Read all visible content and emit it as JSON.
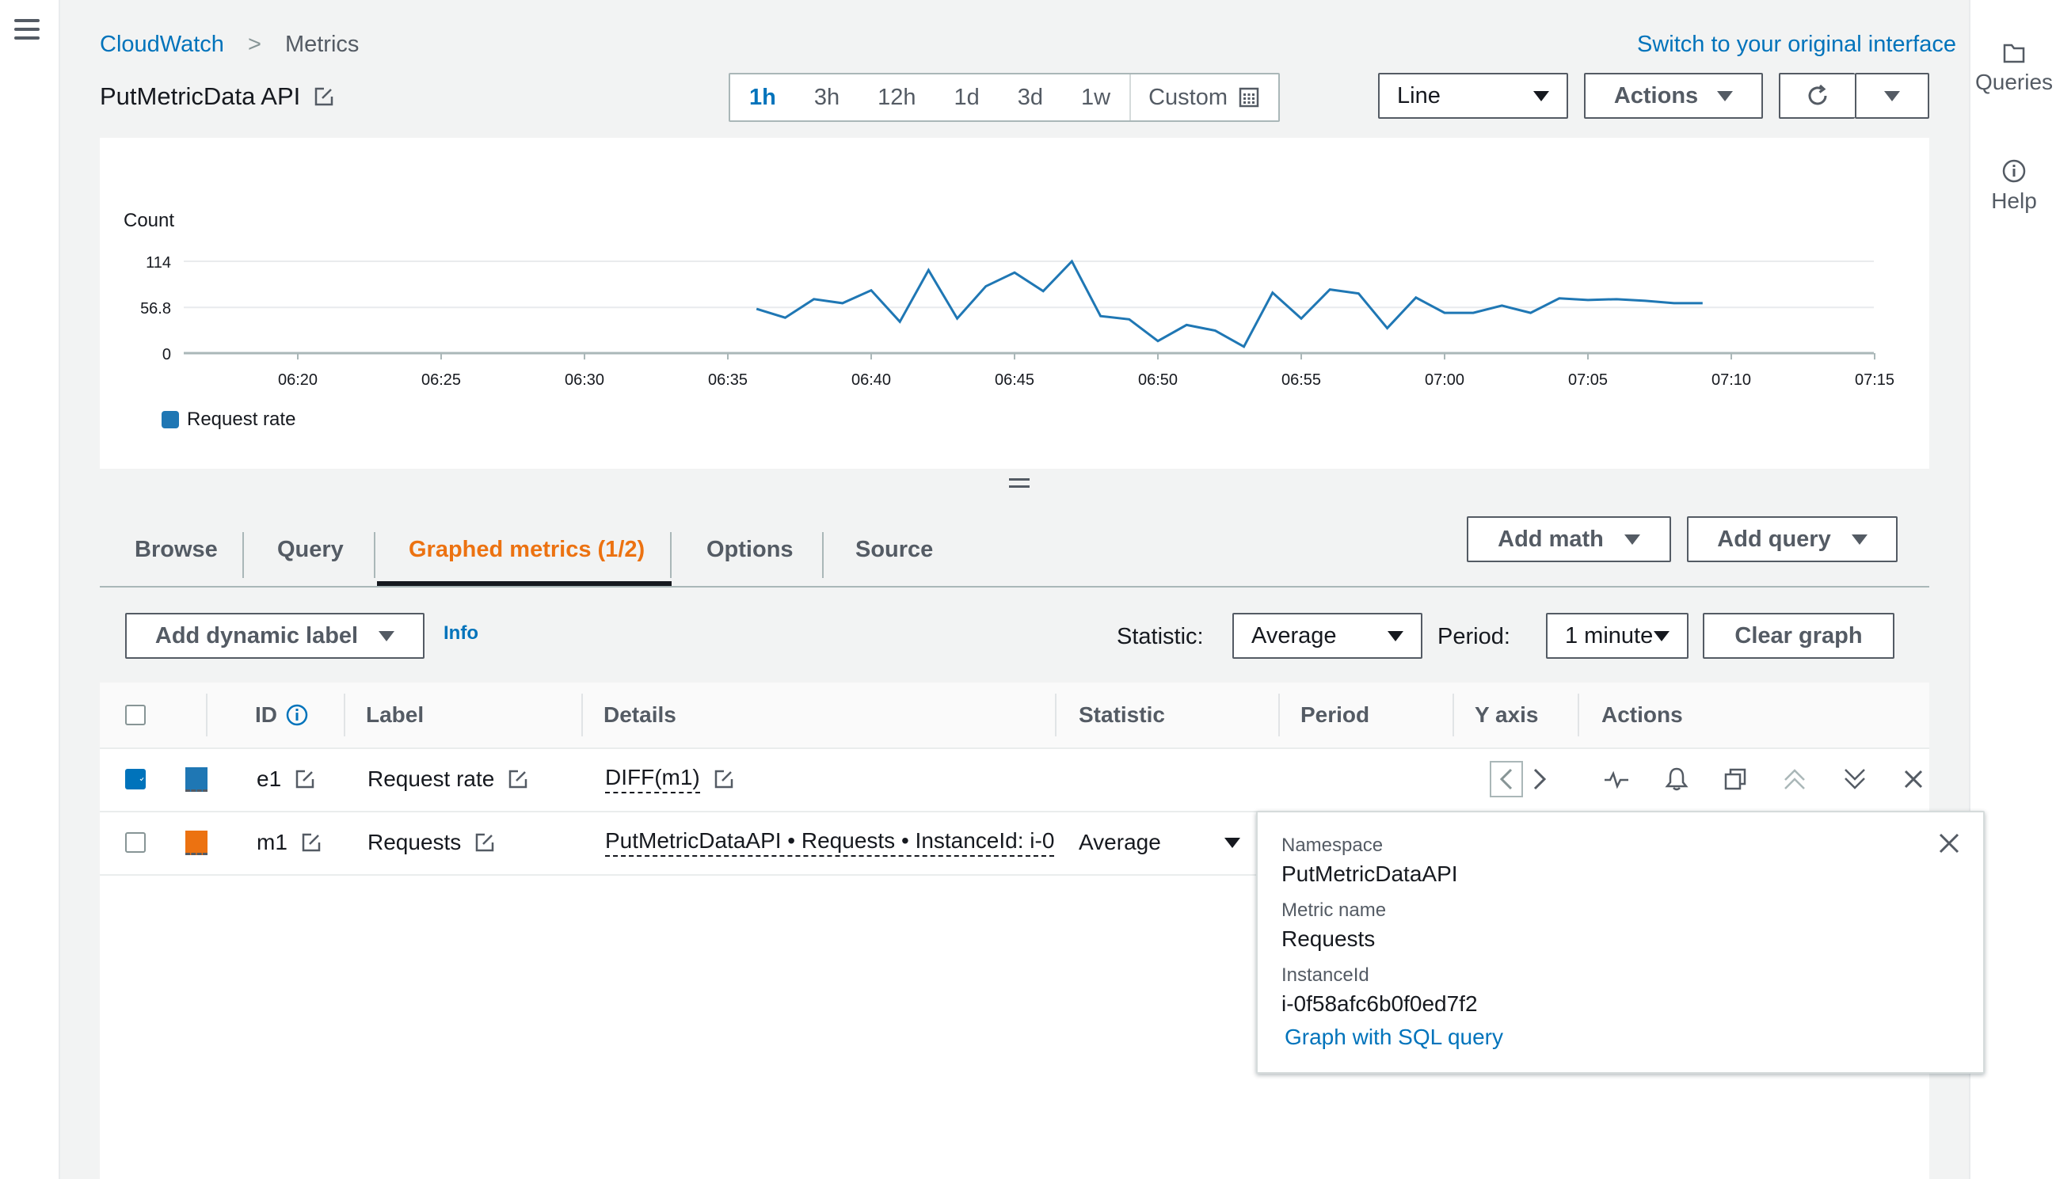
{
  "breadcrumb": {
    "root": "CloudWatch",
    "current": "Metrics"
  },
  "header": {
    "switch_link": "Switch to your original interface",
    "title": "PutMetricData API"
  },
  "time_range": {
    "options": [
      "1h",
      "3h",
      "12h",
      "1d",
      "3d",
      "1w"
    ],
    "selected": "1h",
    "custom_label": "Custom"
  },
  "toolbar": {
    "graph_type": "Line",
    "actions_label": "Actions"
  },
  "right_panel": {
    "queries_label": "Queries",
    "help_label": "Help"
  },
  "chart_data": {
    "type": "line",
    "ylabel": "Count",
    "yticks": [
      "114",
      "56.8",
      "0"
    ],
    "ylim": [
      0,
      114
    ],
    "xticks": [
      "06:20",
      "06:25",
      "06:30",
      "06:35",
      "06:40",
      "06:45",
      "06:50",
      "06:55",
      "07:00",
      "07:05",
      "07:10",
      "07:15"
    ],
    "xlim_minutes": [
      0,
      60
    ],
    "grid": true,
    "legend_position": "bottom-left",
    "series": [
      {
        "name": "Request rate",
        "color": "#1f77b4",
        "x": [
          "06:36",
          "06:37",
          "06:38",
          "06:39",
          "06:40",
          "06:41",
          "06:42",
          "06:43",
          "06:44",
          "06:45",
          "06:46",
          "06:47",
          "06:48",
          "06:49",
          "06:50",
          "06:51",
          "06:52",
          "06:53",
          "06:54",
          "06:55",
          "06:56",
          "06:57",
          "06:58",
          "06:59",
          "07:00",
          "07:01",
          "07:02",
          "07:03",
          "07:04",
          "07:05",
          "07:06",
          "07:07",
          "07:08",
          "07:09"
        ],
        "y": [
          55,
          44,
          67,
          62,
          78,
          39,
          103,
          43,
          83,
          100,
          77,
          114,
          46,
          42,
          15,
          35,
          28,
          8,
          75,
          43,
          79,
          74,
          31,
          69,
          50,
          50,
          59,
          50,
          68,
          66,
          67,
          65,
          62,
          62
        ]
      }
    ]
  },
  "tabs": [
    {
      "label": "Browse"
    },
    {
      "label": "Query"
    },
    {
      "label": "Graphed metrics (1/2)"
    },
    {
      "label": "Options"
    },
    {
      "label": "Source"
    }
  ],
  "tab_actions": {
    "add_math": "Add math",
    "add_query": "Add query"
  },
  "metrics_toolbar": {
    "add_dynamic_label": "Add dynamic label",
    "info": "Info",
    "statistic_label": "Statistic:",
    "statistic_value": "Average",
    "period_label": "Period:",
    "period_value": "1 minute",
    "clear_graph": "Clear graph"
  },
  "table": {
    "headers": {
      "id": "ID",
      "label": "Label",
      "details": "Details",
      "statistic": "Statistic",
      "period": "Period",
      "y_axis": "Y axis",
      "actions": "Actions"
    },
    "rows": [
      {
        "checked": true,
        "color": "#1f77b4",
        "id": "e1",
        "label": "Request rate",
        "details": "DIFF(m1)",
        "statistic": "",
        "period": ""
      },
      {
        "checked": false,
        "color": "#ec7211",
        "id": "m1",
        "label": "Requests",
        "details": "PutMetricDataAPI • Requests • InstanceId: i-0",
        "statistic": "Average",
        "period": ""
      }
    ]
  },
  "popover": {
    "namespace_key": "Namespace",
    "namespace_val": "PutMetricDataAPI",
    "metric_key": "Metric name",
    "metric_val": "Requests",
    "instance_key": "InstanceId",
    "instance_val": "i-0f58afc6b0f0ed7f2",
    "link": "Graph with SQL query"
  }
}
